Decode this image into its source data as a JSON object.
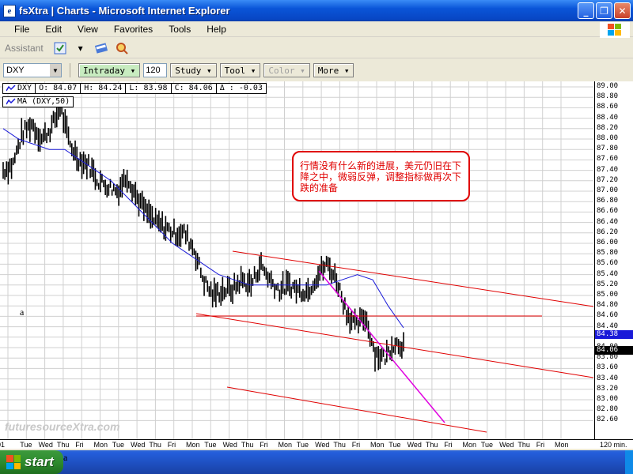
{
  "window": {
    "title": "fsXtra | Charts - Microsoft Internet Explorer",
    "app_icon": "ie-icon",
    "minimize_label": "_",
    "maximize_label": "❐",
    "close_label": "✕"
  },
  "menu": [
    "File",
    "Edit",
    "View",
    "Favorites",
    "Tools",
    "Help"
  ],
  "toolbar": {
    "assistant_label": "Assistant"
  },
  "chart_toolbar": {
    "symbol": "DXY",
    "interval": "Intraday",
    "minutes": "120",
    "study": "Study",
    "tool": "Tool",
    "color": "Color",
    "more": "More"
  },
  "quote": {
    "symbol": "DXY",
    "open": "O: 84.07",
    "high": "H: 84.24",
    "low": "L: 83.98",
    "close": "C: 84.06",
    "change": "Δ : -0.03"
  },
  "ma_label": "MA (DXY,50)",
  "annotation": "行情没有什么新的进展，美元仍旧在下降之中，微弱反弹，调整指标做再次下跌的准备",
  "watermark": "futuresourceXtra.com",
  "y_ticks": [
    "89.00",
    "88.80",
    "88.60",
    "88.40",
    "88.20",
    "88.00",
    "87.80",
    "87.60",
    "87.40",
    "87.20",
    "87.00",
    "86.80",
    "86.60",
    "86.40",
    "86.20",
    "86.00",
    "85.80",
    "85.60",
    "85.40",
    "85.20",
    "85.00",
    "84.80",
    "84.60",
    "84.40",
    "84.20",
    "84.00",
    "83.80",
    "83.60",
    "83.40",
    "83.20",
    "83.00",
    "82.80",
    "82.60"
  ],
  "price_tags": {
    "ma": "84.38",
    "last": "84.06"
  },
  "x_ticks": [
    "01",
    "Tue",
    "Wed",
    "Thu",
    "Fri",
    "Mon",
    "Tue",
    "Wed",
    "Thu",
    "Fri",
    "Mon",
    "Tue",
    "Wed",
    "Thu",
    "Fri",
    "Mon",
    "Tue",
    "Wed",
    "Thu",
    "Fri",
    "Mon",
    "Tue",
    "Wed",
    "Thu",
    "Fri",
    "Mon",
    "Tue",
    "Wed",
    "Thu",
    "Fri",
    "Mon"
  ],
  "x_axis_unit": "120 min.",
  "stray_a": "a",
  "taskbar": {
    "start_label": "start"
  },
  "colors": {
    "titlebar": "#0a55d8",
    "trendline": "#e00000",
    "fast_line": "#e000e0",
    "ma_line": "#1a1ad8"
  },
  "chart_data": {
    "type": "line",
    "title": "",
    "ylim": [
      82.5,
      89.1
    ],
    "y_axis": "right",
    "price_bars_note": "",
    "close_series": [
      87.4,
      87.5,
      88.1,
      88.3,
      88.0,
      88.2,
      88.6,
      87.9,
      87.6,
      87.5,
      87.2,
      87.1,
      87.0,
      87.3,
      86.9,
      86.6,
      86.4,
      86.3,
      86.2,
      86.2,
      85.9,
      85.3,
      85.0,
      85.1,
      85.1,
      85.3,
      85.2,
      85.6,
      85.3,
      85.1,
      85.2,
      85.1,
      85.1,
      85.4,
      85.6,
      85.3,
      84.7,
      84.4,
      84.6,
      83.9,
      83.8,
      84.1,
      84.06
    ],
    "ma_series": [
      88.2,
      88.0,
      87.9,
      87.8,
      87.8,
      87.6,
      87.4,
      87.2,
      86.9,
      86.6,
      86.3,
      86.0,
      85.8,
      85.6,
      85.4,
      85.3,
      85.2,
      85.2,
      85.2,
      85.2,
      85.2,
      85.2,
      85.3,
      85.4,
      85.3,
      84.8,
      84.38
    ]
  }
}
